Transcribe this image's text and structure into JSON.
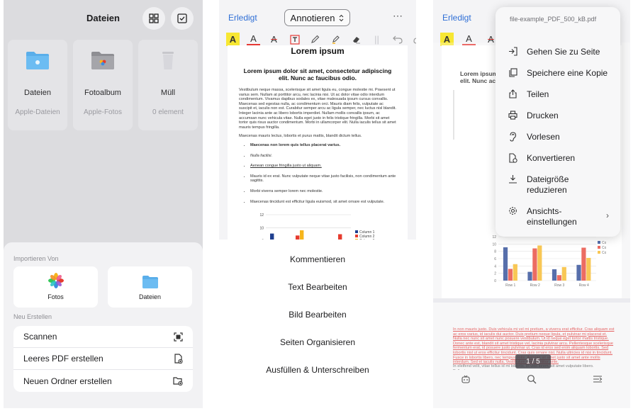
{
  "panel1": {
    "title": "Dateien",
    "tiles": [
      {
        "name": "Dateien",
        "sub": "Apple-Dateien"
      },
      {
        "name": "Fotoalbum",
        "sub": "Apple-Fotos"
      },
      {
        "name": "Müll",
        "sub": "0 element"
      }
    ],
    "import_heading": "Importieren Von",
    "import_sources": [
      {
        "label": "Fotos"
      },
      {
        "label": "Dateien"
      }
    ],
    "create_heading": "Neu Erstellen",
    "create_items": [
      {
        "label": "Scannen"
      },
      {
        "label": "Leeres PDF erstellen"
      },
      {
        "label": "Neuen Ordner erstellen"
      }
    ]
  },
  "panel2": {
    "done": "Erledigt",
    "mode": "Annotieren",
    "more": "⋯",
    "doc": {
      "heading": "Lorem ipsum",
      "subheading": "Lorem ipsum dolor sit amet, consectetur adipiscing elit. Nunc ac faucibus odio.",
      "para1": "Vestibulum neque massa, scelerisque sit amet ligula eu, congue molestie mi. Praesent ut varius sem. Nullam at porttitor arcu, nec lacinia nisi. Ut ac dolor vitae odio interdum condimentum. Vivamus dapibus sodales ex, vitae malesuada ipsum cursus convallis. Maecenas sed egestas nulla, ac condimentum orci. Mauris diam felis, vulputate ac suscipit et, iaculis non est. Curabitur semper arcu ac ligula semper, nec luctus nisl blandit. Integer lacinia ante ac libero lobortis imperdiet. Nullam mollis convallis ipsum, ac accumsan nunc vehicula vitae. Nulla eget justo in felis tristique fringilla. Morbi sit amet tortor quis risus auctor condimentum. Morbi in ullamcorper elit. Nulla iaculis tellus sit amet mauris tempus fringilla.",
      "para2": "Maecenas mauris lectus, lobortis et purus mattis, blandit dictum tellus.",
      "bullets": [
        "Maecenas non lorem quis tellus placerat varius.",
        "Nulla facilisi.",
        "Aenean congue fringilla justo ut aliquam.",
        "Mauris id ex erat. Nunc vulputate neque vitae justo facilisis, non condimentum ante sagittis.",
        "Morbi viverra semper lorem nec molestie.",
        "Maecenas tincidunt est efficitur ligula euismod, sit amet ornare est vulputate."
      ]
    },
    "menu": [
      "Kommentieren",
      "Text Bearbeiten",
      "Bild Bearbeiten",
      "Seiten Organisieren",
      "Ausfüllen & Unterschreiben"
    ]
  },
  "panel3": {
    "done": "Erledigt",
    "file_name": "file-example_PDF_500_kB.pdf",
    "menu": [
      "Gehen Sie zu Seite",
      "Speichere eine Kopie",
      "Teilen",
      "Drucken",
      "Vorlesen",
      "Konvertieren",
      "Dateigröße reduzieren",
      "Ansichts-einstellungen"
    ],
    "page_indicator": "1 / 5",
    "doc": {
      "subheading": "Lorem ipsum dolor sit amet, consectetur adipiscing elit. Nunc ac faucibus odio.",
      "page2_text": "In non mauris justo. Duis vehicula mi vel mi pretium, a viverra erat efficitur. Cras aliquam est ac eros varius, id iaculis dui auctor. Duis pretium neque ligula, et pulvinar mi placerat et. Nulla nec nunc sit amet nunc posuere vestibulum. Ut id neque eget tortor mattis tristique. Donec ante est, blandit sit amet tristique vel, lacinia pulvinar arcu. Pellentesque scelerisque fermentum erat, id posuere justo pulvinar ut. Cras id eros sed enim aliquam lobortis. Sed lobortis nisl ut eros efficitur tincidunt. Cras quis ornare nisl. Nulla ultricies id nisi in tincidunt. Fusce in lobortis libero, nec tempus dolor. Aenean sit amet justo sit amet ante mollis interdum. Sed et iaculis nulla. Vestibulum eget porttitor ante.",
      "page2_text2": "In eleifend velit, vitae tellus id mi lobortis. In velit lorem, sit amet vulputate libero. Pellentesque"
    }
  },
  "chart_data": [
    {
      "type": "bar",
      "categories": [
        "Row 1",
        "Row 2",
        "Row 3",
        "Row 4"
      ],
      "series": [
        {
          "name": "Column 1",
          "values": [
            9.1,
            2.4,
            3.1,
            4.3
          ]
        },
        {
          "name": "Column 2",
          "values": [
            3.2,
            8.8,
            1.5,
            9.0
          ]
        },
        {
          "name": "Column 3",
          "values": [
            4.5,
            9.6,
            3.7,
            6.2
          ]
        }
      ],
      "ylim": [
        0,
        12
      ],
      "yticks": [
        0,
        2,
        4,
        6,
        8,
        10,
        12
      ],
      "colors": [
        "#1f3f8f",
        "#e63b2e",
        "#f6b51c"
      ]
    }
  ]
}
